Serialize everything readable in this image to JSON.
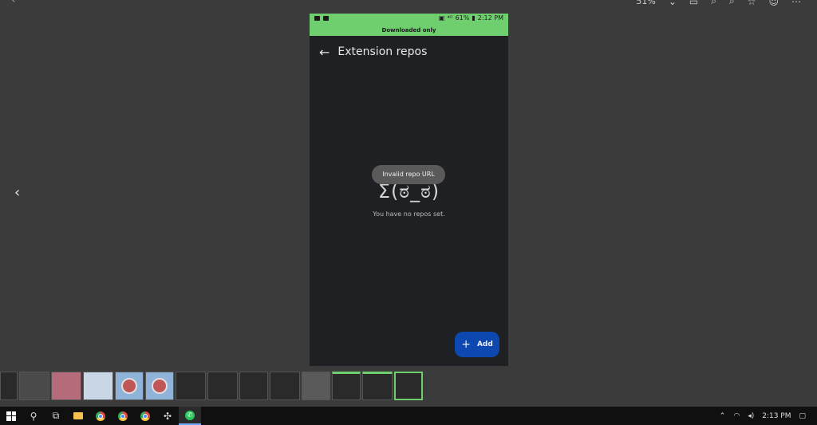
{
  "viewer": {
    "zoom_label": "51%",
    "prev_icon": "chevron-left-icon"
  },
  "phone": {
    "status": {
      "battery": "61%",
      "time": "2:12 PM",
      "banner": "Downloaded only",
      "color": "#6fcf6f"
    },
    "app_bar": {
      "title": "Extension repos"
    },
    "toast": "Invalid repo URL",
    "empty_state": {
      "kaomoji": "Σ(ಠ_ಠ)",
      "message": "You have no repos set."
    },
    "fab": {
      "label": "Add",
      "color": "#0d47b0"
    }
  },
  "taskbar": {
    "clock": "2:13 PM"
  }
}
